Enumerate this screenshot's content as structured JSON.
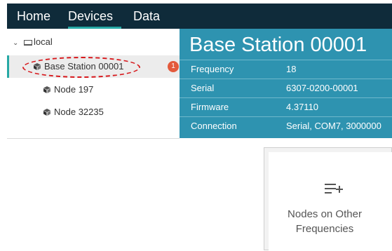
{
  "nav": {
    "tabs": [
      {
        "label": "Home"
      },
      {
        "label": "Devices"
      },
      {
        "label": "Data"
      }
    ],
    "active_tab": "Devices"
  },
  "tree": {
    "root": {
      "label": "local",
      "icon": "laptop-icon",
      "expanded": true
    },
    "items": [
      {
        "label": "Base Station 00001",
        "icon": "device-cube-icon",
        "badge": "1",
        "selected": true
      },
      {
        "label": "Node 197",
        "icon": "device-cube-icon"
      },
      {
        "label": "Node 32235",
        "icon": "device-cube-icon"
      }
    ]
  },
  "details": {
    "title": "Base Station 00001",
    "properties": [
      {
        "label": "Frequency",
        "value": "18"
      },
      {
        "label": "Serial",
        "value": "6307-0200-00001"
      },
      {
        "label": "Firmware",
        "value": "4.37110"
      },
      {
        "label": "Connection",
        "value": "Serial, COM7, 3000000"
      }
    ]
  },
  "card": {
    "icon": "list-add-icon",
    "line1": "Nodes on Other",
    "line2": "Frequencies"
  },
  "colors": {
    "nav_background": "#0f2b3a",
    "accent": "#26a9a5",
    "details_background": "#2e93b0",
    "badge": "#e35a3c",
    "highlight_ring": "#d7181c"
  }
}
